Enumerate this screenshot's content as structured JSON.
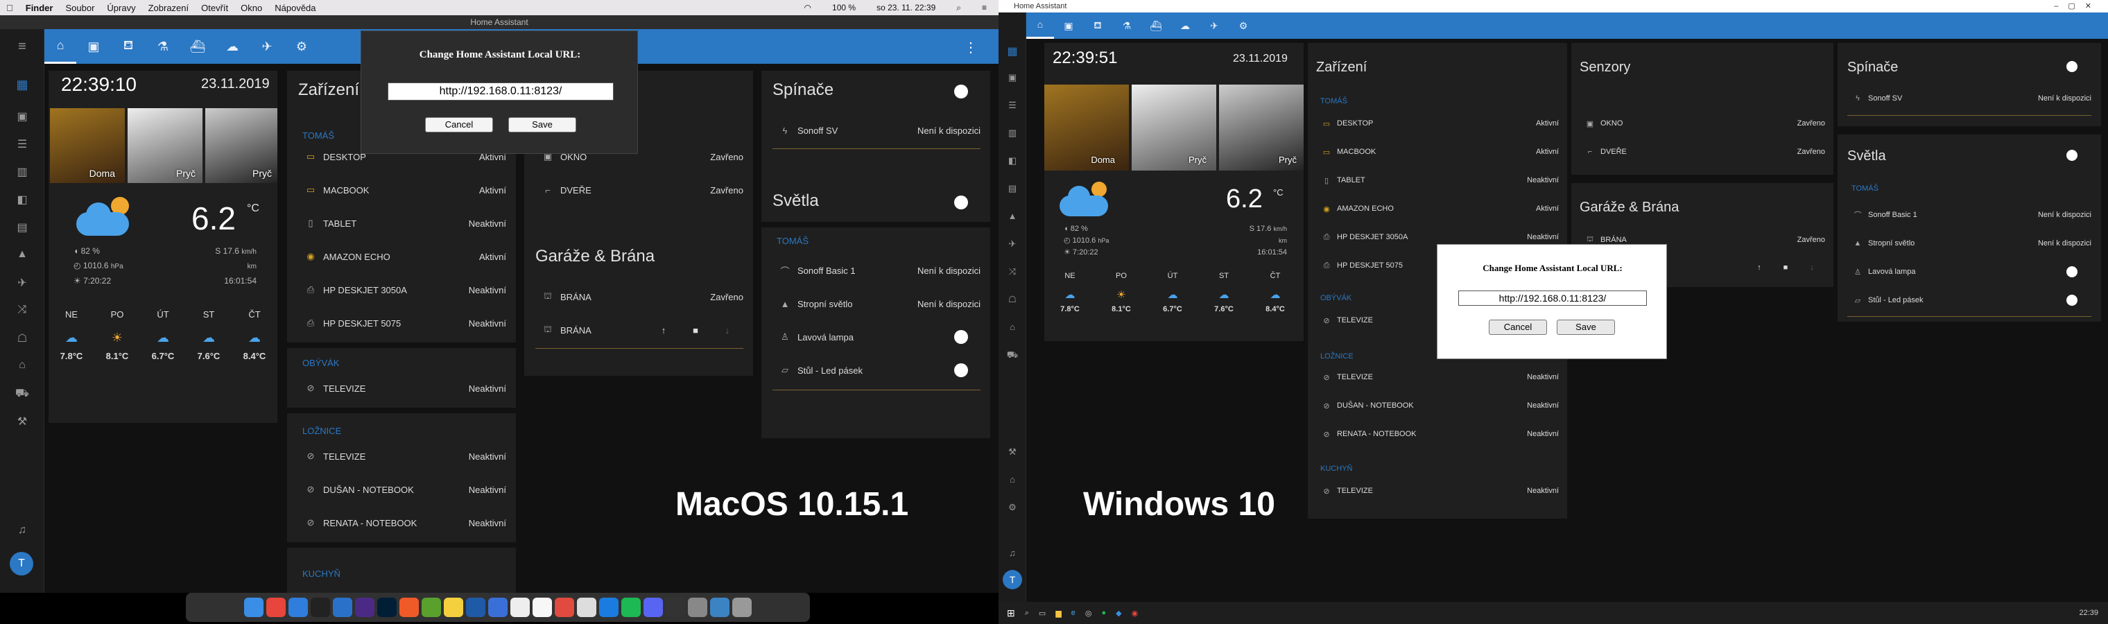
{
  "mac": {
    "menubar": [
      "Finder",
      "Soubor",
      "Úpravy",
      "Zobrazení",
      "Otevřít",
      "Okno",
      "Nápověda"
    ],
    "status": {
      "battery": "100 %",
      "datetime": "so 23. 11.  22:39"
    },
    "window_title": "Home Assistant",
    "label": "MacOS 10.15.1"
  },
  "win": {
    "window_title": "Home Assistant",
    "label": "Windows 10",
    "clock": "22:39"
  },
  "left": {
    "time": "22:39:10",
    "date": "23.11.2019",
    "devices_title": "Zařízení",
    "sensors": [
      {
        "name": "OKNO",
        "state": "Zavřeno"
      },
      {
        "name": "DVEŘE",
        "state": "Zavřeno"
      }
    ]
  },
  "right": {
    "time": "22:39:51",
    "date": "23.11.2019",
    "devices_title": "Zařízení",
    "sensors_title": "Senzory",
    "sensors": [
      {
        "name": "OKNO",
        "state": "Zavřeno"
      },
      {
        "name": "DVEŘE",
        "state": "Zavřeno"
      }
    ]
  },
  "persons": [
    {
      "state": "Doma"
    },
    {
      "state": "Pryč"
    },
    {
      "state": "Pryč"
    }
  ],
  "weather": {
    "temp": "6.2",
    "unit": "°C",
    "humidity": "82 %",
    "pressure": "1010.6",
    "pressure_unit": "hPa",
    "wind": "S 17.6",
    "wind_unit": "km/h",
    "wind_unit_short": "km",
    "sunrise": "7:20:22",
    "sunset": "16:01:54",
    "forecast": [
      {
        "day": "NE",
        "temp": "7.8°C"
      },
      {
        "day": "PO",
        "temp": "8.1°C"
      },
      {
        "day": "ÚT",
        "temp": "6.7°C"
      },
      {
        "day": "ST",
        "temp": "7.6°C"
      },
      {
        "day": "ČT",
        "temp": "8.4°C"
      }
    ]
  },
  "devices": {
    "tomas_label": "TOMÁŠ",
    "tomas": [
      {
        "name": "DESKTOP",
        "state": "Aktivní"
      },
      {
        "name": "MACBOOK",
        "state": "Aktivní"
      },
      {
        "name": "TABLET",
        "state": "Neaktivní"
      },
      {
        "name": "AMAZON ECHO",
        "state": "Aktivní"
      },
      {
        "name": "HP DESKJET 3050A",
        "state": "Neaktivní"
      },
      {
        "name": "HP DESKJET 5075",
        "state": "Neaktivní"
      }
    ],
    "obyvak_label": "OBÝVÁK",
    "obyvak": [
      {
        "name": "TELEVIZE",
        "state": "Neaktivní"
      }
    ],
    "loznice_label": "LOŽNICE",
    "loznice": [
      {
        "name": "TELEVIZE",
        "state": "Neaktivní"
      },
      {
        "name": "DUŠAN - NOTEBOOK",
        "state": "Neaktivní"
      },
      {
        "name": "RENATA - NOTEBOOK",
        "state": "Neaktivní"
      }
    ],
    "kuchyn_label": "KUCHYŇ",
    "kuchyn": [
      {
        "name": "TELEVIZE",
        "state": "Neaktivní"
      }
    ]
  },
  "garage": {
    "title": "Garáže & Brána",
    "items": [
      {
        "name": "BRÁNA",
        "state": "Zavřeno"
      },
      {
        "name": "BRÁNA",
        "state": ""
      }
    ]
  },
  "switches": {
    "title": "Spínače",
    "items": [
      {
        "name": "Sonoff SV",
        "state": "Není k dispozici"
      }
    ]
  },
  "lights": {
    "title": "Světla",
    "section": "TOMÁŠ",
    "items": [
      {
        "name": "Sonoff Basic 1",
        "state": "Není k dispozici"
      },
      {
        "name": "Stropní světlo",
        "state": "Není k dispozici"
      },
      {
        "name": "Lavová lampa",
        "state": ""
      },
      {
        "name": "Stůl - Led pásek",
        "state": ""
      }
    ]
  },
  "dialog": {
    "title": "Change Home Assistant Local URL:",
    "url": "http://192.168.0.11:8123/",
    "cancel": "Cancel",
    "save": "Save"
  },
  "avatar_letter": "T",
  "colors": {
    "primary": "#2b78c4",
    "accent": "#7a6230",
    "background": "#111111"
  }
}
